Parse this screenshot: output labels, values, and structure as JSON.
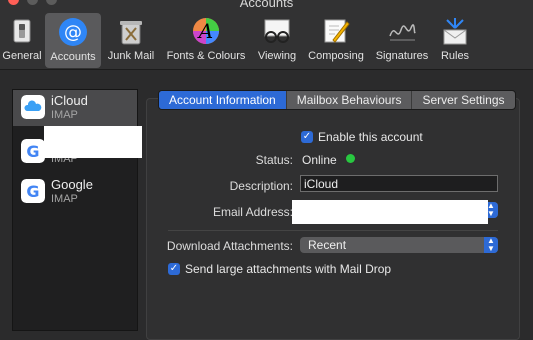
{
  "window": {
    "title": "Accounts"
  },
  "toolbar": {
    "items": [
      {
        "label": "General",
        "icon": "general-switch-icon"
      },
      {
        "label": "Accounts",
        "icon": "at-sign-icon"
      },
      {
        "label": "Junk Mail",
        "icon": "trash-icon"
      },
      {
        "label": "Fonts & Colours",
        "icon": "color-wheel-icon"
      },
      {
        "label": "Viewing",
        "icon": "glasses-icon"
      },
      {
        "label": "Composing",
        "icon": "pencil-icon"
      },
      {
        "label": "Signatures",
        "icon": "signature-icon"
      },
      {
        "label": "Rules",
        "icon": "envelope-arrows-icon"
      }
    ]
  },
  "sidebar": {
    "accounts": [
      {
        "name": "iCloud",
        "type": "IMAP",
        "icon": "icloud-icon"
      },
      {
        "name": "",
        "type": "IMAP",
        "icon": "google-icon"
      },
      {
        "name": "Google",
        "type": "IMAP",
        "icon": "google-icon"
      }
    ]
  },
  "tabs": [
    "Account Information",
    "Mailbox Behaviours",
    "Server Settings"
  ],
  "form": {
    "enable_label": "Enable this account",
    "status_label": "Status:",
    "status_value": "Online",
    "description_label": "Description:",
    "description_value": "iCloud",
    "email_label": "Email Address:",
    "download_label": "Download Attachments:",
    "download_value": "Recent",
    "maildrop_label": "Send large attachments with Mail Drop"
  },
  "colors": {
    "accent": "#2d6ad6",
    "online": "#28c840"
  }
}
